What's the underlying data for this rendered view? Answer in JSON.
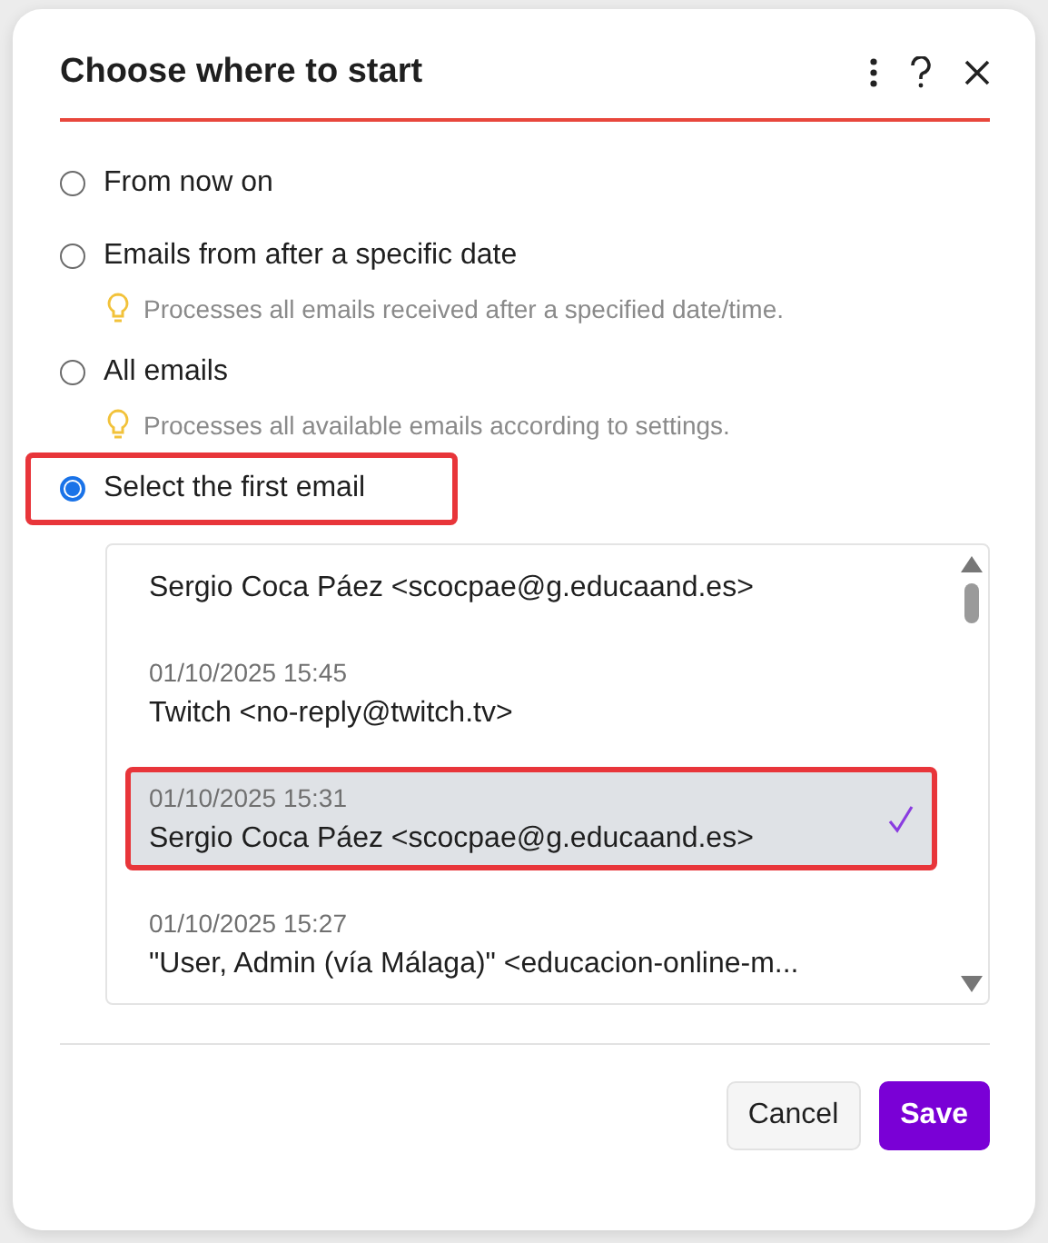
{
  "dialog": {
    "title": "Choose where to start"
  },
  "options": [
    {
      "label": "From now on",
      "selected": false,
      "highlighted": false
    },
    {
      "label": "Emails from after a specific date",
      "selected": false,
      "highlighted": false,
      "hint": "Processes all emails received after a specified date/time."
    },
    {
      "label": "All emails",
      "selected": false,
      "highlighted": false,
      "hint": "Processes all available emails according to settings."
    },
    {
      "label": "Select the first email",
      "selected": true,
      "highlighted": true
    }
  ],
  "emails": [
    {
      "sender": "Sergio Coca Páez <scocpae@g.educaand.es>",
      "selected": false,
      "highlighted": false
    },
    {
      "date": "01/10/2025 15:45",
      "sender": "Twitch <no-reply@twitch.tv>",
      "selected": false,
      "highlighted": false
    },
    {
      "date": "01/10/2025 15:31",
      "sender": "Sergio Coca Páez <scocpae@g.educaand.es>",
      "selected": true,
      "highlighted": true
    },
    {
      "date": "01/10/2025 15:27",
      "sender": "\"User, Admin (vía Málaga)\" <educacion-online-m...",
      "selected": false,
      "highlighted": false
    }
  ],
  "buttons": [
    {
      "label": "Cancel",
      "kind": "secondary"
    },
    {
      "label": "Save",
      "kind": "primary"
    }
  ]
}
